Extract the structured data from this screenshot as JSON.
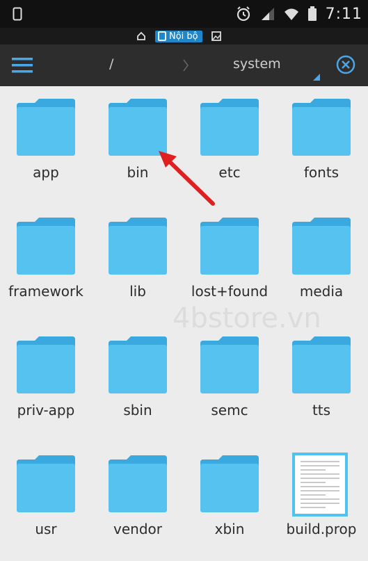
{
  "status_bar": {
    "time": "7:11",
    "icons": [
      "phone-icon",
      "alarm-icon",
      "signal-icon",
      "wifi-icon",
      "battery-icon"
    ]
  },
  "storage": {
    "label": "Nội bộ",
    "icons": [
      "home-icon",
      "storage-icon",
      "gallery-icon"
    ]
  },
  "toolbar": {
    "path": [
      "/",
      "system"
    ],
    "icons": [
      "menu-icon",
      "close-icon"
    ]
  },
  "files": [
    {
      "name": "app",
      "type": "folder"
    },
    {
      "name": "bin",
      "type": "folder"
    },
    {
      "name": "etc",
      "type": "folder"
    },
    {
      "name": "fonts",
      "type": "folder"
    },
    {
      "name": "framework",
      "type": "folder"
    },
    {
      "name": "lib",
      "type": "folder"
    },
    {
      "name": "lost+found",
      "type": "folder"
    },
    {
      "name": "media",
      "type": "folder"
    },
    {
      "name": "priv-app",
      "type": "folder"
    },
    {
      "name": "sbin",
      "type": "folder"
    },
    {
      "name": "semc",
      "type": "folder"
    },
    {
      "name": "tts",
      "type": "folder"
    },
    {
      "name": "usr",
      "type": "folder"
    },
    {
      "name": "vendor",
      "type": "folder"
    },
    {
      "name": "xbin",
      "type": "folder"
    },
    {
      "name": "build.prop",
      "type": "file"
    }
  ],
  "watermark": "4bstore.vn",
  "colors": {
    "folder_back": "#3aa9e0",
    "folder_front": "#56c2f0",
    "accent": "#1f86c9",
    "arrow": "#e02020"
  }
}
